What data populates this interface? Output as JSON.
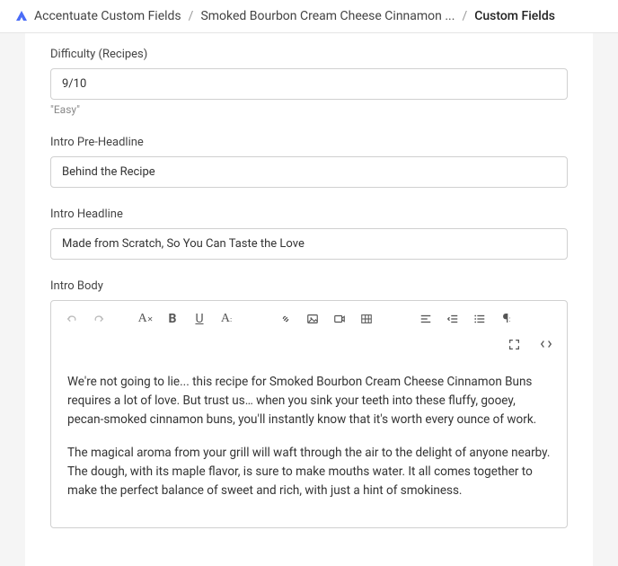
{
  "breadcrumb": {
    "app": "Accentuate Custom Fields",
    "item": "Smoked Bourbon Cream Cheese Cinnamon ...",
    "current": "Custom Fields"
  },
  "fields": {
    "difficulty": {
      "label": "Difficulty (Recipes)",
      "value": "9/10",
      "hint": "\"Easy\""
    },
    "preHeadline": {
      "label": "Intro Pre-Headline",
      "value": "Behind the Recipe"
    },
    "headline": {
      "label": "Intro Headline",
      "value": "Made from Scratch, So You Can Taste the Love"
    },
    "body": {
      "label": "Intro Body",
      "p1": "We're not going to lie... this recipe for Smoked Bourbon Cream Cheese Cinnamon Buns requires a lot of love. But trust us… when you sink your teeth into these fluffy, gooey, pecan-smoked cinnamon buns, you'll instantly know that it's worth every ounce of work.",
      "p2": "The magical aroma from your grill will waft through the air to the delight of anyone nearby. The dough, with its maple flavor, is sure to make mouths water. It all comes together to make the perfect balance of sweet and rich, with just a hint of smokiness."
    }
  }
}
